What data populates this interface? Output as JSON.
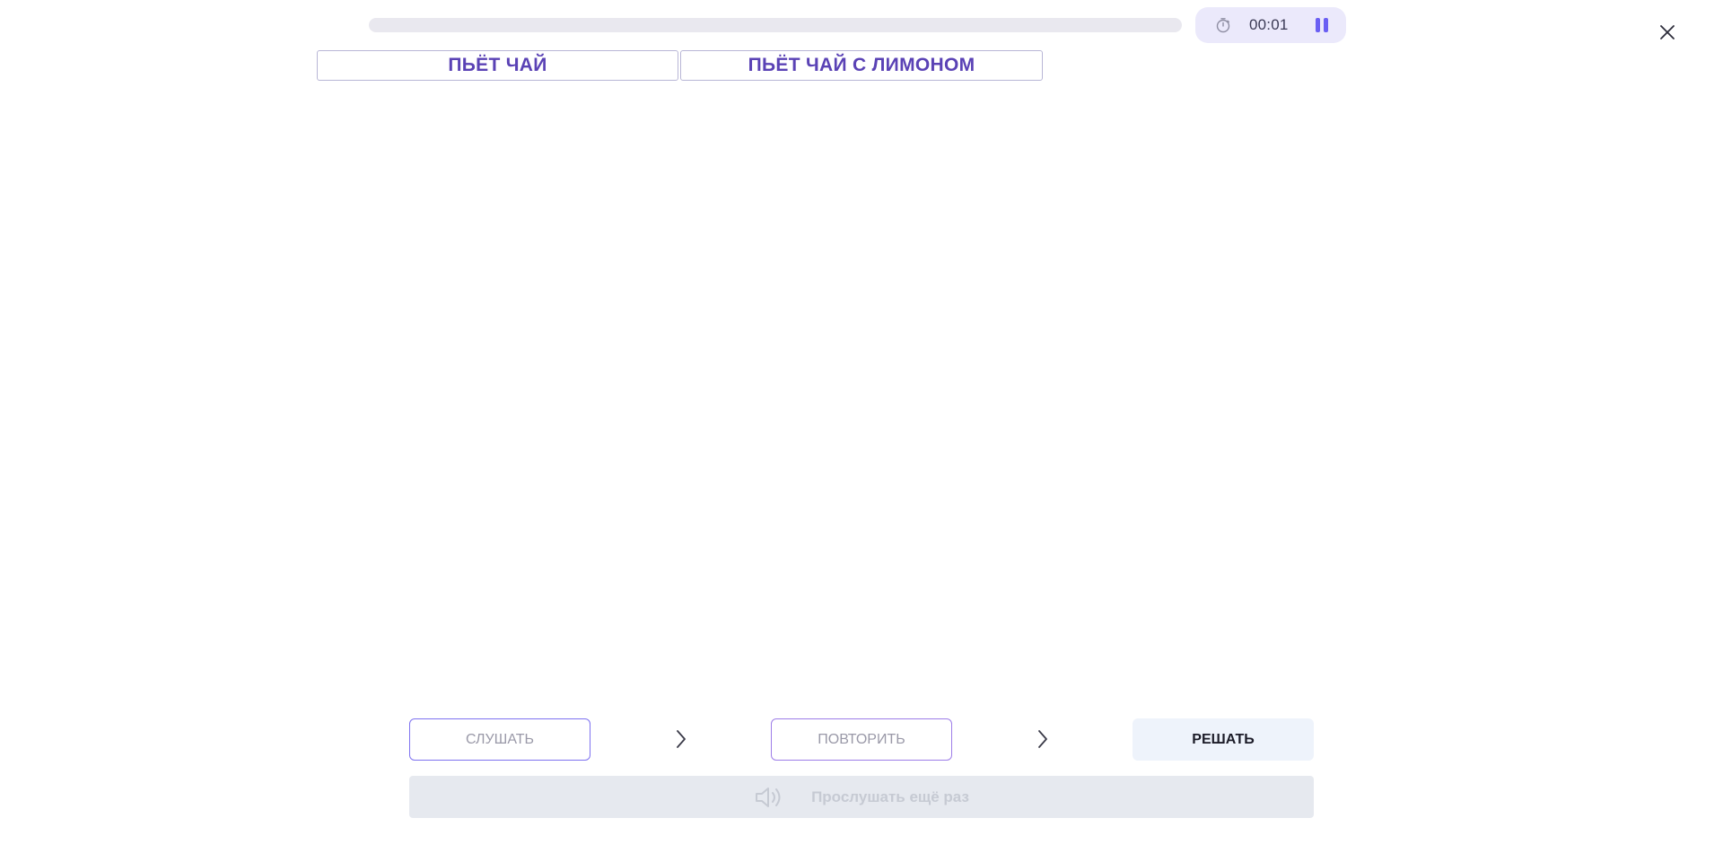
{
  "header": {
    "progress_fraction": 0.0,
    "timer": "00:01",
    "icons": {
      "timer": "stopwatch-icon",
      "pause": "pause-icon",
      "close": "close-icon"
    }
  },
  "answers": [
    {
      "label": "ПЬЁТ ЧАЙ"
    },
    {
      "label": "ПЬЁТ ЧАЙ С ЛИМОНОМ"
    }
  ],
  "steps": {
    "listen": "СЛУШАТЬ",
    "repeat": "ПОВТОРИТЬ",
    "solve": "РЕШАТЬ"
  },
  "replay": {
    "label": "Прослушать ещё раз",
    "icon": "speaker-icon"
  },
  "colors": {
    "accent": "#6a5ff3",
    "chip_text": "#5a42b5"
  }
}
